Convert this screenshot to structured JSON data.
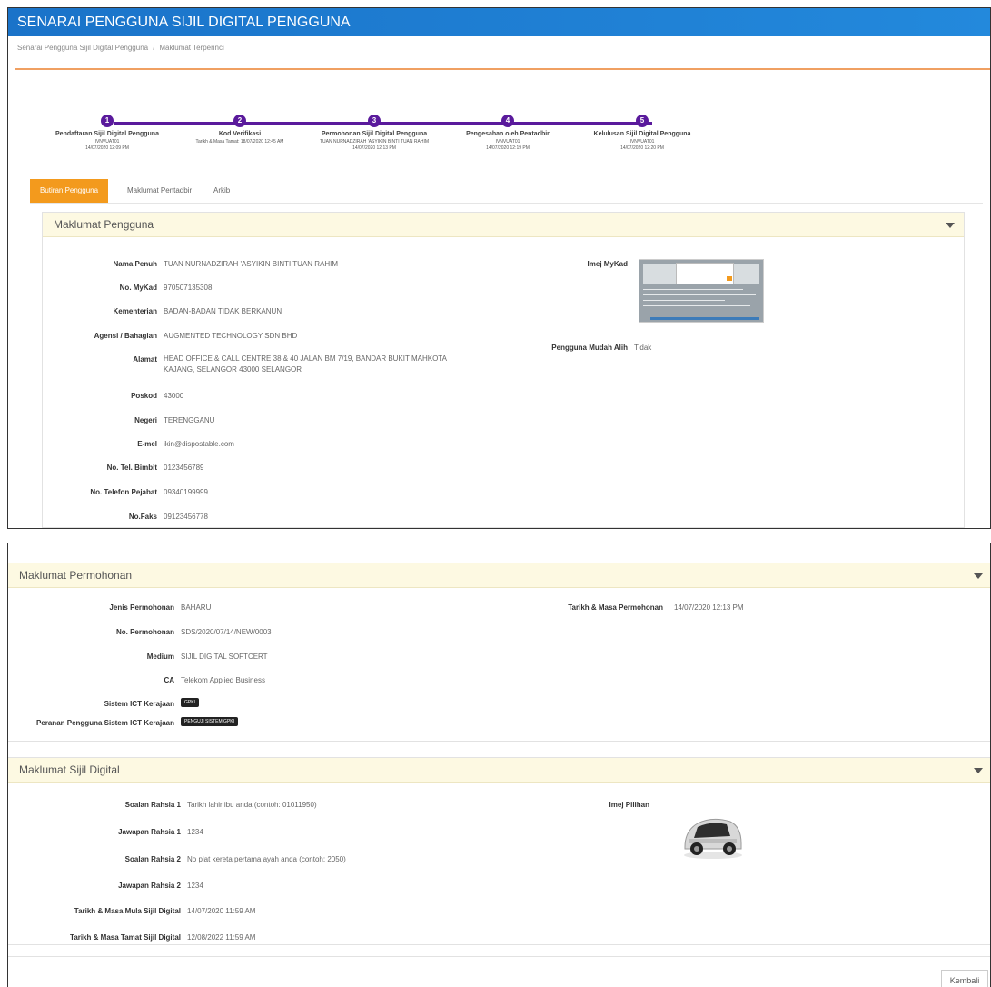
{
  "header": {
    "title": "SENARAI PENGGUNA SIJIL DIGITAL PENGGUNA"
  },
  "breadcrumb": [
    "Senarai Pengguna Sijil Digital Pengguna",
    "Maklumat Terperinci"
  ],
  "steps": [
    {
      "num": "1",
      "title": "Pendaftaran Sijil Digital Pengguna",
      "lines": [
        "IVNVUAT01",
        "14/07/2020 12:09 PM"
      ]
    },
    {
      "num": "2",
      "title": "Kod Verifikasi",
      "lines": [
        "Tarikh & Masa Tamat: 18/07/2020 12:45 AM"
      ]
    },
    {
      "num": "3",
      "title": "Permohonan Sijil Digital Pengguna",
      "lines": [
        "TUAN NURNADZIRAH 'ASYIKIN BINTI TUAN RAHIM",
        "14/07/2020 12:13 PM"
      ]
    },
    {
      "num": "4",
      "title": "Pengesahan oleh Pentadbir",
      "lines": [
        "IVNVUAT01",
        "14/07/2020 12:19 PM"
      ]
    },
    {
      "num": "5",
      "title": "Kelulusan Sijil Digital Pengguna",
      "lines": [
        "IVNVUAT01",
        "14/07/2020 12:20 PM"
      ]
    }
  ],
  "tabs": [
    "Butiran Pengguna",
    "Maklumat Pentadbir",
    "Arkib"
  ],
  "pengguna": {
    "title": "Maklumat Pengguna",
    "fields": [
      {
        "label": "Nama Penuh",
        "value": "TUAN NURNADZIRAH 'ASYIKIN BINTI TUAN RAHIM"
      },
      {
        "label": "No. MyKad",
        "value": "970507135308"
      },
      {
        "label": "Kementerian",
        "value": "BADAN-BADAN TIDAK BERKANUN"
      },
      {
        "label": "Agensi / Bahagian",
        "value": "AUGMENTED TECHNOLOGY SDN BHD"
      },
      {
        "label": "Alamat",
        "value": "HEAD OFFICE & CALL CENTRE 38 & 40 JALAN BM 7/19, BANDAR BUKIT MAHKOTA KAJANG, SELANGOR 43000 SELANGOR"
      },
      {
        "label": "Poskod",
        "value": "43000"
      },
      {
        "label": "Negeri",
        "value": "TERENGGANU"
      },
      {
        "label": "E-mel",
        "value": "ikin@dispostable.com"
      },
      {
        "label": "No. Tel. Bimbit",
        "value": "0123456789"
      },
      {
        "label": "No. Telefon Pejabat",
        "value": "09340199999"
      },
      {
        "label": "No.Faks",
        "value": "09123456778"
      }
    ],
    "imej_label": "Imej MyKad",
    "mudah_alih_label": "Pengguna Mudah Alih",
    "mudah_alih_value": "Tidak"
  },
  "permohonan": {
    "title": "Maklumat Permohonan",
    "fields": [
      {
        "label": "Jenis Permohonan",
        "value": "BAHARU"
      },
      {
        "label": "No. Permohonan",
        "value": "SDS/2020/07/14/NEW/0003"
      },
      {
        "label": "Medium",
        "value": "SIJIL DIGITAL SOFTCERT"
      },
      {
        "label": "CA",
        "value": "Telekom Applied Business"
      }
    ],
    "sistem_label": "Sistem ICT Kerajaan",
    "sistem_badge": "GPKI",
    "peranan_label": "Peranan Pengguna Sistem ICT Kerajaan",
    "peranan_badge": "PENGUJI SISTEM GPKI",
    "tarikh_label": "Tarikh & Masa Permohonan",
    "tarikh_value": "14/07/2020 12:13 PM"
  },
  "sijil": {
    "title": "Maklumat Sijil Digital",
    "fields": [
      {
        "label": "Soalan Rahsia 1",
        "value": "Tarikh lahir ibu anda (contoh: 01011950)"
      },
      {
        "label": "Jawapan Rahsia 1",
        "value": "1234"
      },
      {
        "label": "Soalan Rahsia 2",
        "value": "No plat kereta pertama ayah anda (contoh: 2050)"
      },
      {
        "label": "Jawapan Rahsia 2",
        "value": "1234"
      },
      {
        "label": "Tarikh & Masa Mula Sijil Digital",
        "value": "14/07/2020 11:59 AM"
      },
      {
        "label": "Tarikh & Masa Tamat Sijil Digital",
        "value": "12/08/2022 11:59 AM"
      }
    ],
    "imej_label": "Imej Pilihan"
  },
  "footer": {
    "back_label": "Kembali"
  }
}
